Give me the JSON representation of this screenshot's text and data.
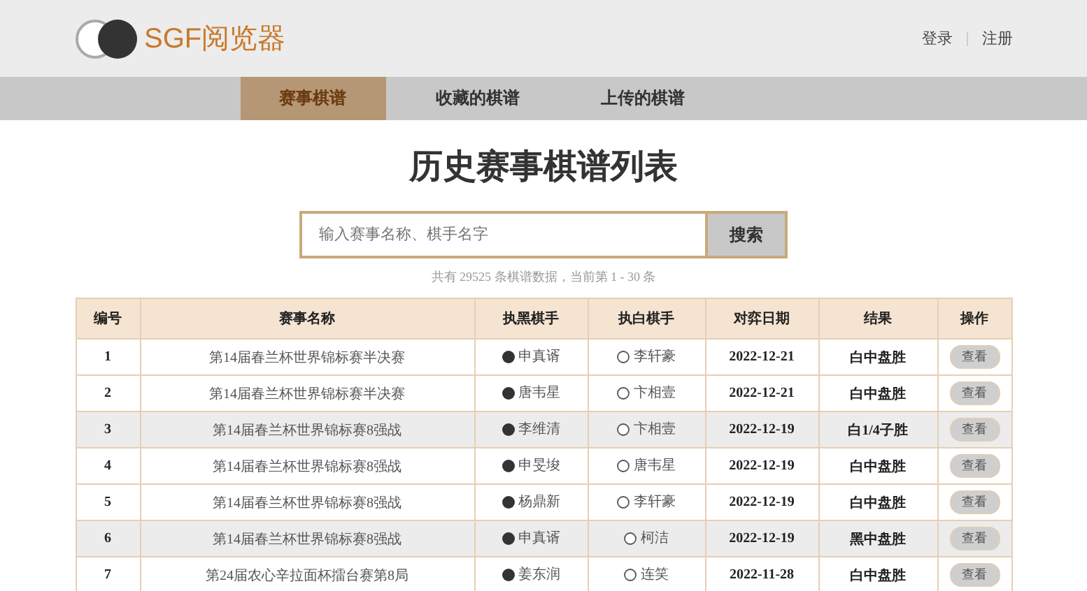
{
  "logo": {
    "text": "SGF阅览器"
  },
  "auth_links": [
    "登录",
    "注册"
  ],
  "tabs": [
    {
      "label": "赛事棋谱",
      "selected": true
    },
    {
      "label": "收藏的棋谱",
      "selected": false
    },
    {
      "label": "上传的棋谱",
      "selected": false
    }
  ],
  "title": "历史赛事棋谱列表",
  "search": {
    "placeholder": "输入赛事名称、棋手名字",
    "button": "搜索"
  },
  "summary": "共有 29525 条棋谱数据，当前第 1 - 30 条",
  "table": {
    "columns": [
      "编号",
      "赛事名称",
      "执黑棋手",
      "执白棋手",
      "对弈日期",
      "结果",
      "操作"
    ],
    "rows": [
      {
        "no": "1",
        "event": "第14届春兰杯世界锦标赛半决赛",
        "black": "申真谞",
        "white": "李轩豪",
        "date": "2022-12-21",
        "result": "白中盘胜",
        "action": "查看",
        "highlighted": false
      },
      {
        "no": "2",
        "event": "第14届春兰杯世界锦标赛半决赛",
        "black": "唐韦星",
        "white": "卞相壹",
        "date": "2022-12-21",
        "result": "白中盘胜",
        "action": "查看",
        "highlighted": false
      },
      {
        "no": "3",
        "event": "第14届春兰杯世界锦标赛8强战",
        "black": "李维清",
        "white": "卞相壹",
        "date": "2022-12-19",
        "result": "白1/4子胜",
        "action": "查看",
        "highlighted": true
      },
      {
        "no": "4",
        "event": "第14届春兰杯世界锦标赛8强战",
        "black": "申旻埈",
        "white": "唐韦星",
        "date": "2022-12-19",
        "result": "白中盘胜",
        "action": "查看",
        "highlighted": false
      },
      {
        "no": "5",
        "event": "第14届春兰杯世界锦标赛8强战",
        "black": "杨鼎新",
        "white": "李轩豪",
        "date": "2022-12-19",
        "result": "白中盘胜",
        "action": "查看",
        "highlighted": false
      },
      {
        "no": "6",
        "event": "第14届春兰杯世界锦标赛8强战",
        "black": "申真谞",
        "white": "柯洁",
        "date": "2022-12-19",
        "result": "黑中盘胜",
        "action": "查看",
        "highlighted": true
      },
      {
        "no": "7",
        "event": "第24届农心辛拉面杯擂台赛第8局",
        "black": "姜东润",
        "white": "连笑",
        "date": "2022-11-28",
        "result": "白中盘胜",
        "action": "查看",
        "highlighted": false
      }
    ]
  }
}
